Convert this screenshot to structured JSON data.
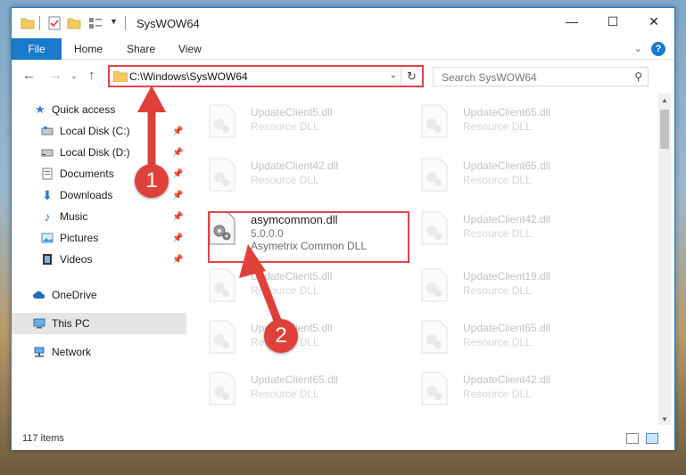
{
  "window": {
    "title": "SysWOW64",
    "minimize_glyph": "—",
    "maximize_glyph": "☐",
    "close_glyph": "✕"
  },
  "ribbon": {
    "tabs": [
      {
        "label": "File"
      },
      {
        "label": "Home"
      },
      {
        "label": "Share"
      },
      {
        "label": "View"
      }
    ]
  },
  "address": {
    "path": "C:\\Windows\\SysWOW64",
    "search_placeholder": "Search SysWOW64"
  },
  "sidebar": {
    "items": [
      {
        "label": "Quick access",
        "icon": "star-icon"
      },
      {
        "label": "Local Disk (C:)",
        "icon": "drive-icon",
        "pinned": true
      },
      {
        "label": "Local Disk (D:)",
        "icon": "drive-icon",
        "pinned": true
      },
      {
        "label": "Documents",
        "icon": "documents-icon",
        "pinned": true
      },
      {
        "label": "Downloads",
        "icon": "download-icon",
        "pinned": true
      },
      {
        "label": "Music",
        "icon": "music-icon",
        "pinned": true
      },
      {
        "label": "Pictures",
        "icon": "pictures-icon",
        "pinned": true
      },
      {
        "label": "Videos",
        "icon": "videos-icon",
        "pinned": true
      },
      {
        "label": "OneDrive",
        "icon": "cloud-icon"
      },
      {
        "label": "This PC",
        "icon": "computer-icon",
        "selected": true
      },
      {
        "label": "Network",
        "icon": "network-icon"
      }
    ]
  },
  "files": {
    "col1": [
      {
        "name": "UpdateClient5.dll",
        "type": "Resource DLL"
      },
      {
        "name": "UpdateClient42.dll",
        "type": "Resource DLL"
      },
      {
        "name": "asymcommon.dll",
        "version": "5.0.0.0",
        "type": "Asymetrix Common DLL",
        "featured": true
      },
      {
        "name": "UpdateClient5.dll",
        "type": "Resource DLL"
      },
      {
        "name": "UpdateClient5.dll",
        "type": "Resource DLL"
      },
      {
        "name": "UpdateClient65.dll",
        "type": "Resource DLL"
      }
    ],
    "col2": [
      {
        "name": "UpdateClient65.dll",
        "type": "Resource DLL"
      },
      {
        "name": "UpdateClient65.dll",
        "type": "Resource DLL"
      },
      {
        "name": "UpdateClient42.dll",
        "type": "Resource DLL"
      },
      {
        "name": "UpdateClient19.dll",
        "type": "Resource DLL"
      },
      {
        "name": "UpdateClient65.dll",
        "type": "Resource DLL"
      },
      {
        "name": "UpdateClient42.dll",
        "type": "Resource DLL"
      }
    ]
  },
  "status": {
    "item_count": "117 items"
  },
  "annotations": {
    "step1": "1",
    "step2": "2",
    "color": "#e0403a"
  }
}
